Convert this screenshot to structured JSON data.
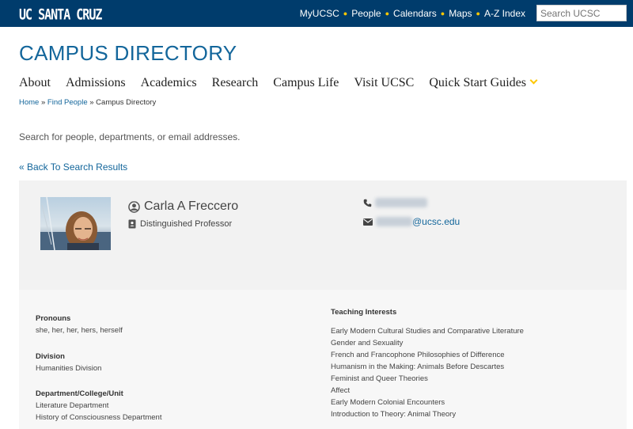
{
  "header": {
    "logo_text": "UC SANTA CRUZ",
    "links": [
      "MyUCSC",
      "People",
      "Calendars",
      "Maps",
      "A-Z Index"
    ],
    "search_placeholder": "Search UCSC"
  },
  "page_title": "CAMPUS DIRECTORY",
  "nav": [
    "About",
    "Admissions",
    "Academics",
    "Research",
    "Campus Life",
    "Visit UCSC",
    "Quick Start Guides"
  ],
  "breadcrumb": {
    "home": "Home",
    "sep1": " » ",
    "find_people": "Find People",
    "sep2": " » ",
    "current": "Campus Directory"
  },
  "intro_text": "Search for people, departments, or email addresses.",
  "back_link": "« Back To Search Results",
  "profile": {
    "name": "Carla A Freccero",
    "title": "Distinguished Professor",
    "email_domain": "@ucsc.edu"
  },
  "details": {
    "pronouns_label": "Pronouns",
    "pronouns_value": "she, her, her, hers, herself",
    "division_label": "Division",
    "division_value": "Humanities Division",
    "department_label": "Department/College/Unit",
    "departments": [
      "Literature Department",
      "History of Consciousness Department"
    ],
    "teaching_label": "Teaching Interests",
    "teaching_interests": [
      "Early Modern Cultural Studies and Comparative Literature",
      "Gender and Sexuality",
      "French and Francophone Philosophies of Difference",
      "Humanism in the Making: Animals Before Descartes",
      "Feminist and Queer Theories",
      "Affect",
      "Early Modern Colonial Encounters",
      "Introduction to Theory: Animal Theory"
    ]
  },
  "colors": {
    "header_bg": "#003c6c",
    "accent_gold": "#fdc700",
    "link_blue": "#13669b"
  }
}
